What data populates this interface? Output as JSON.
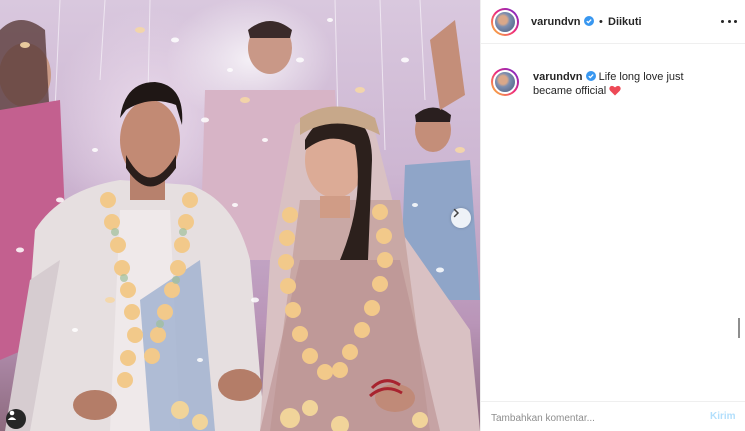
{
  "post": {
    "username": "varundvn",
    "separator": "•",
    "follow_status": "Diikuti",
    "caption_user": "varundvn",
    "caption_text": "Life long love just became official",
    "caption_emoji": "heart-emoji"
  },
  "comment": {
    "placeholder": "Tambahkan komentar...",
    "post_label": "Kirim"
  },
  "icons": {
    "verified": "verified-badge-icon",
    "more": "more-options-icon",
    "next": "chevron-right-icon",
    "tag": "user-tag-icon",
    "heart": "heart-emoji"
  },
  "colors": {
    "verified_blue": "#3897f0",
    "post_button_disabled": "#b2dffc",
    "heart_red": "#ed4956"
  }
}
